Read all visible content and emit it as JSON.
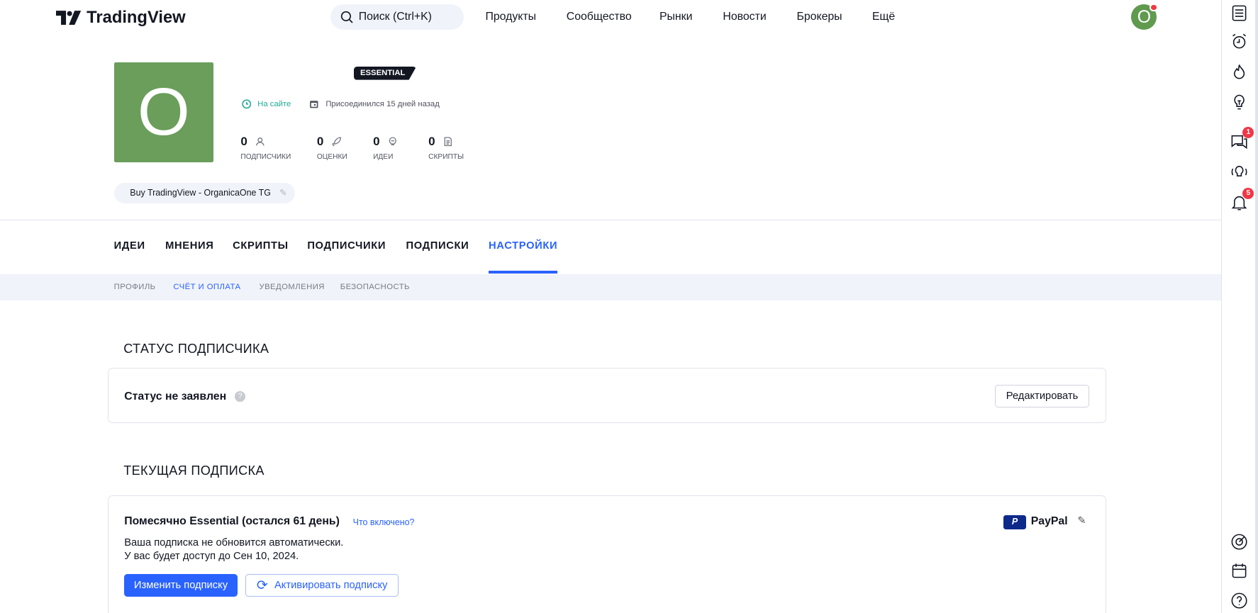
{
  "header": {
    "logo": "TradingView",
    "search_placeholder": "Поиск (Ctrl+K)",
    "nav": [
      "Продукты",
      "Сообщество",
      "Рынки",
      "Новости",
      "Брокеры",
      "Ещё"
    ],
    "avatar_letter": "O"
  },
  "sidebar": {
    "chat_badge": "1",
    "alerts_badge": "5"
  },
  "profile": {
    "avatar_letter": "O",
    "plan_badge": "ESSENTIAL",
    "online": "На сайте",
    "joined": "Присоединился 15 дней назад",
    "stats": [
      {
        "value": "0",
        "label": "ПОДПИСЧИКИ"
      },
      {
        "value": "0",
        "label": "ОЦЕНКИ"
      },
      {
        "value": "0",
        "label": "ИДЕИ"
      },
      {
        "value": "0",
        "label": "СКРИПТЫ"
      }
    ],
    "link_chip": "Buy TradingView - OrganicaOne TG"
  },
  "tabs": [
    "ИДЕИ",
    "МНЕНИЯ",
    "СКРИПТЫ",
    "ПОДПИСЧИКИ",
    "ПОДПИСКИ",
    "НАСТРОЙКИ"
  ],
  "subtabs": [
    "ПРОФИЛЬ",
    "СЧЁТ И ОПЛАТА",
    "УВЕДОМЛЕНИЯ",
    "БЕЗОПАСНОСТЬ"
  ],
  "status_section": {
    "title": "СТАТУС ПОДПИСЧИКА",
    "status": "Статус не заявлен",
    "edit_button": "Редактировать"
  },
  "subscription": {
    "title": "ТЕКУЩАЯ ПОДПИСКА",
    "plan": "Помесячно Essential (остался 61 день)",
    "whats_included": "Что включено?",
    "line1": "Ваша подписка не обновится автоматически.",
    "line2": "У вас будет доступ до Сен 10, 2024.",
    "change_button": "Изменить подписку",
    "activate_button": "Активировать подписку",
    "payment_method": "PayPal"
  }
}
